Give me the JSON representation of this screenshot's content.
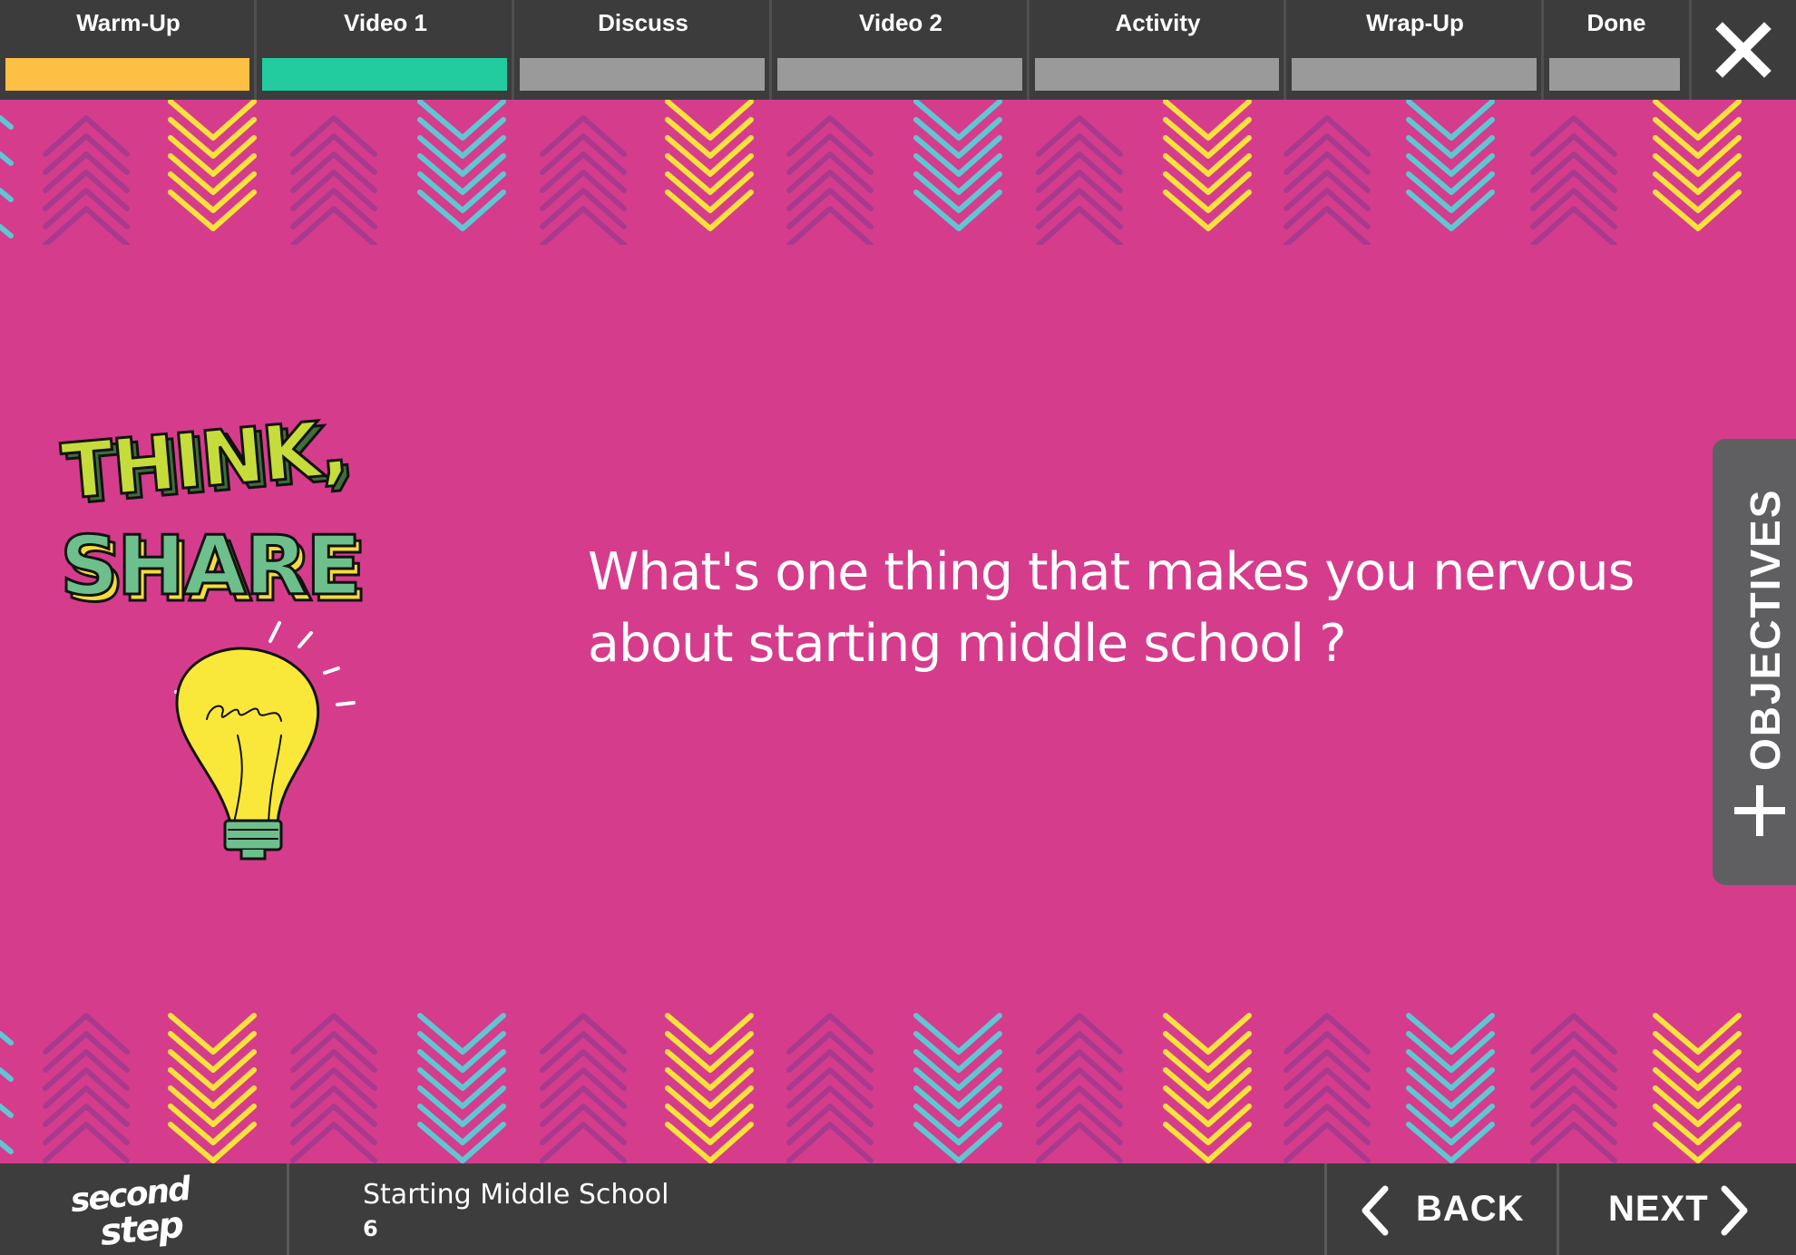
{
  "tabs": [
    {
      "label": "Warm-Up",
      "status": "complete",
      "color": "#fcc045"
    },
    {
      "label": "Video 1",
      "status": "current",
      "color": "#22cc9f"
    },
    {
      "label": "Discuss",
      "status": "upcoming",
      "color": "#9a9a9a"
    },
    {
      "label": "Video 2",
      "status": "upcoming",
      "color": "#9a9a9a"
    },
    {
      "label": "Activity",
      "status": "upcoming",
      "color": "#9a9a9a"
    },
    {
      "label": "Wrap-Up",
      "status": "upcoming",
      "color": "#9a9a9a"
    },
    {
      "label": "Done",
      "status": "upcoming",
      "color": "#9a9a9a"
    }
  ],
  "close_icon": "close-icon",
  "slide": {
    "graphic": {
      "line1": "THINK,",
      "line2": "SHARE",
      "icon": "lightbulb-icon"
    },
    "question": {
      "line1": "What's one thing that makes you nervous",
      "line2": "about starting middle school ?"
    },
    "background_color": "#d63c8c",
    "pattern_colors": [
      "#a83a8e",
      "#f9e23c",
      "#5ec7d2"
    ]
  },
  "objectives": {
    "label": "OBJECTIVES",
    "icon": "plus-icon"
  },
  "footer": {
    "logo": {
      "line1": "second",
      "line2": "step"
    },
    "lesson_title": "Starting Middle School",
    "lesson_number": "6",
    "back_label": "BACK",
    "back_icon": "chevron-left-icon",
    "next_label": "NEXT",
    "next_icon": "chevron-right-icon"
  }
}
